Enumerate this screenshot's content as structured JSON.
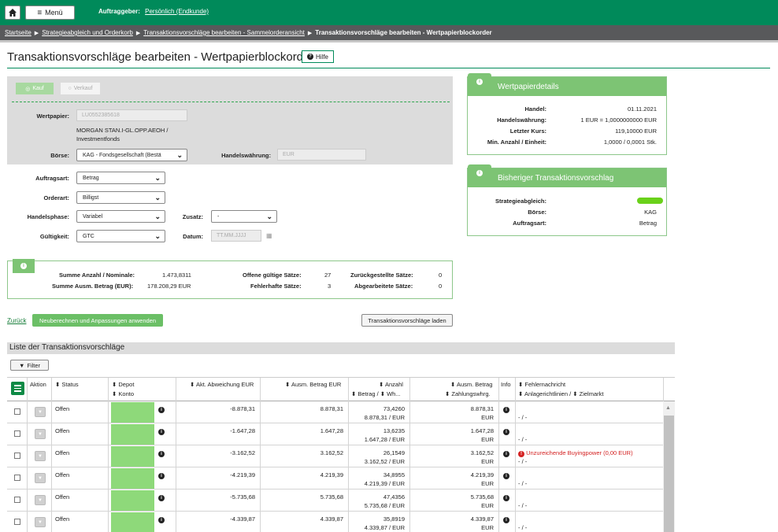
{
  "header": {
    "menu_label": "Menü",
    "auftraggeber_label": "Auftraggeber:",
    "auftraggeber_value": "Persönlich (Endkunde)"
  },
  "breadcrumb": [
    "Startseite",
    "Strategieabgleich und Orderkorb",
    "Transaktionsvorschläge bearbeiten - Sammelorderansicht",
    "Transaktionsvorschläge bearbeiten - Wertpapierblockorder"
  ],
  "page": {
    "title": "Transaktionsvorschläge bearbeiten - Wertpapierblockorder",
    "help_label": "Hilfe"
  },
  "form": {
    "kauf_label": "Kauf",
    "verkauf_label": "Verkauf",
    "wertpapier_label": "Wertpapier:",
    "wertpapier_value": "LU0552385618",
    "wertpapier_name": "MORGAN STAN.I-GL.OPP.AEOH /",
    "wertpapier_type": "Investmentfonds",
    "boerse_label": "Börse:",
    "boerse_value": "KAG - Fondsgesellschaft (Bestä",
    "handelswaehrung_label": "Handelswährung:",
    "handelswaehrung_value": "EUR",
    "auftragsart_label": "Auftragsart:",
    "auftragsart_value": "Betrag",
    "orderart_label": "Orderart:",
    "orderart_value": "Billigst",
    "handelsphase_label": "Handelsphase:",
    "handelsphase_value": "Variabel",
    "zusatz_label": "Zusatz:",
    "zusatz_value": "-",
    "gueltigkeit_label": "Gültigkeit:",
    "gueltigkeit_value": "GTC",
    "datum_label": "Datum:",
    "datum_placeholder": "TT.MM.JJJJ"
  },
  "summary": {
    "summe_anzahl_label": "Summe Anzahl / Nominale:",
    "summe_anzahl_value": "1.473,8311",
    "summe_betrag_label": "Summe Ausm. Betrag (EUR):",
    "summe_betrag_value": "178.208,29 EUR",
    "offene_label": "Offene gültige Sätze:",
    "offene_value": "27",
    "fehlerhafte_label": "Fehlerhafte Sätze:",
    "fehlerhafte_value": "3",
    "zurueck_label": "Zurückgestellte Sätze:",
    "zurueck_value": "0",
    "abgearbeitet_label": "Abgearbeitete Sätze:",
    "abgearbeitet_value": "0"
  },
  "actions": {
    "back_label": "Zurück",
    "recalc_label": "Neuberechnen und Anpassungen anwenden",
    "load_label": "Transaktionsvorschläge laden"
  },
  "wertpapierdetails": {
    "title": "Wertpapierdetails",
    "rows": [
      {
        "k": "Handel:",
        "v": "01.11.2021"
      },
      {
        "k": "Handelswährung:",
        "v": "1 EUR = 1,0000000000 EUR"
      },
      {
        "k": "Letzter Kurs:",
        "v": "119,10000 EUR"
      },
      {
        "k": "Min. Anzahl / Einheit:",
        "v": "1,0000 / 0,0001 Stk."
      }
    ]
  },
  "bisheriger": {
    "title": "Bisheriger Transaktionsvorschlag",
    "strategie_label": "Strategieabgleich:",
    "boerse_label": "Börse:",
    "boerse_value": "KAG",
    "auftragsart_label": "Auftragsart:",
    "auftragsart_value": "Betrag"
  },
  "list": {
    "title": "Liste der Transaktionsvorschläge",
    "filter_label": "Filter",
    "headers": {
      "aktion": "Aktion",
      "status": "Status",
      "depot": "Depot",
      "konto": "Konto",
      "abweichung": "Akt. Abweichung EUR",
      "ausm_betrag": "Ausm. Betrag EUR",
      "anzahl": "Anzahl",
      "betrag_wh": "Betrag / ⬍ Wh...",
      "ausm_betrag2": "Ausm. Betrag",
      "zahlungswhrg": "Zahlungswhrg.",
      "info": "Info",
      "fehler": "Fehlernachricht",
      "anlage": "Anlagerichtlinien / ⬍ Zielmarkt"
    },
    "rows": [
      {
        "status": "Offen",
        "abweichung": "-8.878,31",
        "betrag": "8.878,31",
        "anzahl1": "73,4260",
        "anzahl2": "8.878,31 / EUR",
        "ausm1": "8.878,31",
        "ausm2": "EUR",
        "fehler": "",
        "anlage": "- / -"
      },
      {
        "status": "Offen",
        "abweichung": "-1.647,28",
        "betrag": "1.647,28",
        "anzahl1": "13,6235",
        "anzahl2": "1.647,28 / EUR",
        "ausm1": "1.647,28",
        "ausm2": "EUR",
        "fehler": "",
        "anlage": "- / -"
      },
      {
        "status": "Offen",
        "abweichung": "-3.162,52",
        "betrag": "3.162,52",
        "anzahl1": "26,1549",
        "anzahl2": "3.162,52 / EUR",
        "ausm1": "3.162,52",
        "ausm2": "EUR",
        "fehler": "Unzureichende Buyingpower (0,00 EUR)",
        "anlage": "- / -"
      },
      {
        "status": "Offen",
        "abweichung": "-4.219,39",
        "betrag": "4.219,39",
        "anzahl1": "34,8955",
        "anzahl2": "4.219,39 / EUR",
        "ausm1": "4.219,39",
        "ausm2": "EUR",
        "fehler": "",
        "anlage": "- / -"
      },
      {
        "status": "Offen",
        "abweichung": "-5.735,68",
        "betrag": "5.735,68",
        "anzahl1": "47,4356",
        "anzahl2": "5.735,68 / EUR",
        "ausm1": "5.735,68",
        "ausm2": "EUR",
        "fehler": "",
        "anlage": "- / -"
      },
      {
        "status": "Offen",
        "abweichung": "-4.339,87",
        "betrag": "4.339,87",
        "anzahl1": "35,8919",
        "anzahl2": "4.339,87 / EUR",
        "ausm1": "4.339,87",
        "ausm2": "EUR",
        "fehler": "",
        "anlage": "- / -"
      }
    ]
  },
  "colors": {
    "brand_green": "#008a5a",
    "accent_green": "#7dc474",
    "error_red": "#d42222"
  }
}
